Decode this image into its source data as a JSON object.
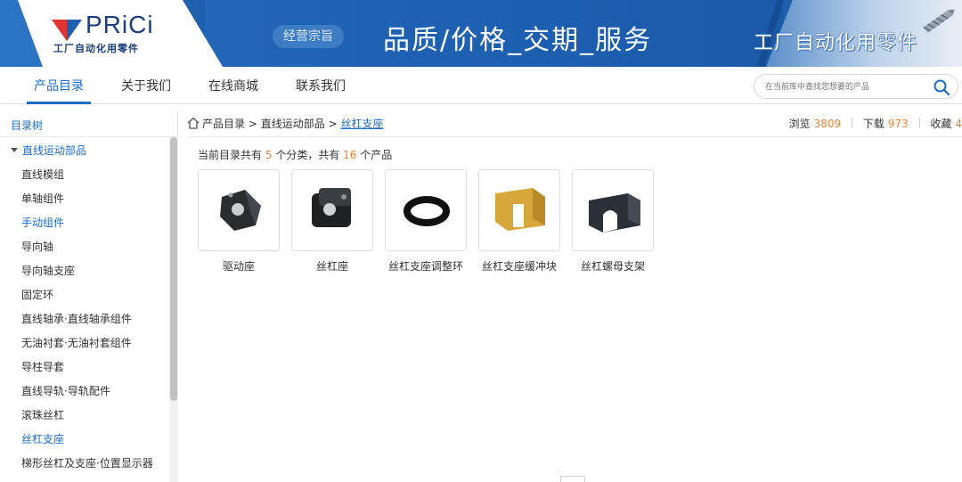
{
  "banner": {
    "logo_text": "PRiCi",
    "logo_sub": "工厂自动化用零件",
    "mission_badge": "经营宗旨",
    "slogan": "品质/价格_交期_服务",
    "right_text": "工厂自动化用零件"
  },
  "nav": {
    "items": [
      {
        "label": "产品目录",
        "active": true
      },
      {
        "label": "关于我们",
        "active": false
      },
      {
        "label": "在线商城",
        "active": false
      },
      {
        "label": "联系我们",
        "active": false
      }
    ],
    "search_placeholder": "在当前库中查找您想要的产品"
  },
  "sidebar": {
    "title": "目录树",
    "parent": "直线运动部品",
    "items": [
      {
        "label": "直线模组",
        "link": false
      },
      {
        "label": "单轴组件",
        "link": false
      },
      {
        "label": "手动组件",
        "link": true
      },
      {
        "label": "导向轴",
        "link": false
      },
      {
        "label": "导向轴支座",
        "link": false
      },
      {
        "label": "固定环",
        "link": false
      },
      {
        "label": "直线轴承·直线轴承组件",
        "link": false
      },
      {
        "label": "无油衬套·无油衬套组件",
        "link": false
      },
      {
        "label": "导柱导套",
        "link": false
      },
      {
        "label": "直线导轨·导轨配件",
        "link": false
      },
      {
        "label": "滚珠丝杠",
        "link": false
      },
      {
        "label": "丝杠支座",
        "link": true
      },
      {
        "label": "梯形丝杠及支座·位置显示器",
        "link": false
      }
    ]
  },
  "breadcrumb": {
    "root": "产品目录",
    "sep": ">",
    "level1": "直线运动部品",
    "current": "丝杠支座"
  },
  "stats": {
    "views_label": "浏览",
    "views": "3809",
    "downloads_label": "下载",
    "downloads": "973",
    "favorites_label": "收藏",
    "favorites": "4"
  },
  "summary": {
    "prefix": "当前目录共有",
    "categories": "5",
    "middle": "个分类，共有",
    "products": "16",
    "suffix": "个产品"
  },
  "products": [
    {
      "label": "驱动座"
    },
    {
      "label": "丝杠座"
    },
    {
      "label": "丝杠支座调整环"
    },
    {
      "label": "丝杠支座缓冲块"
    },
    {
      "label": "丝杠螺母支架"
    }
  ],
  "colors": {
    "accent": "#1e6cc7",
    "highlight_number": "#e8843a",
    "banner_blue": "#1e5fae"
  }
}
